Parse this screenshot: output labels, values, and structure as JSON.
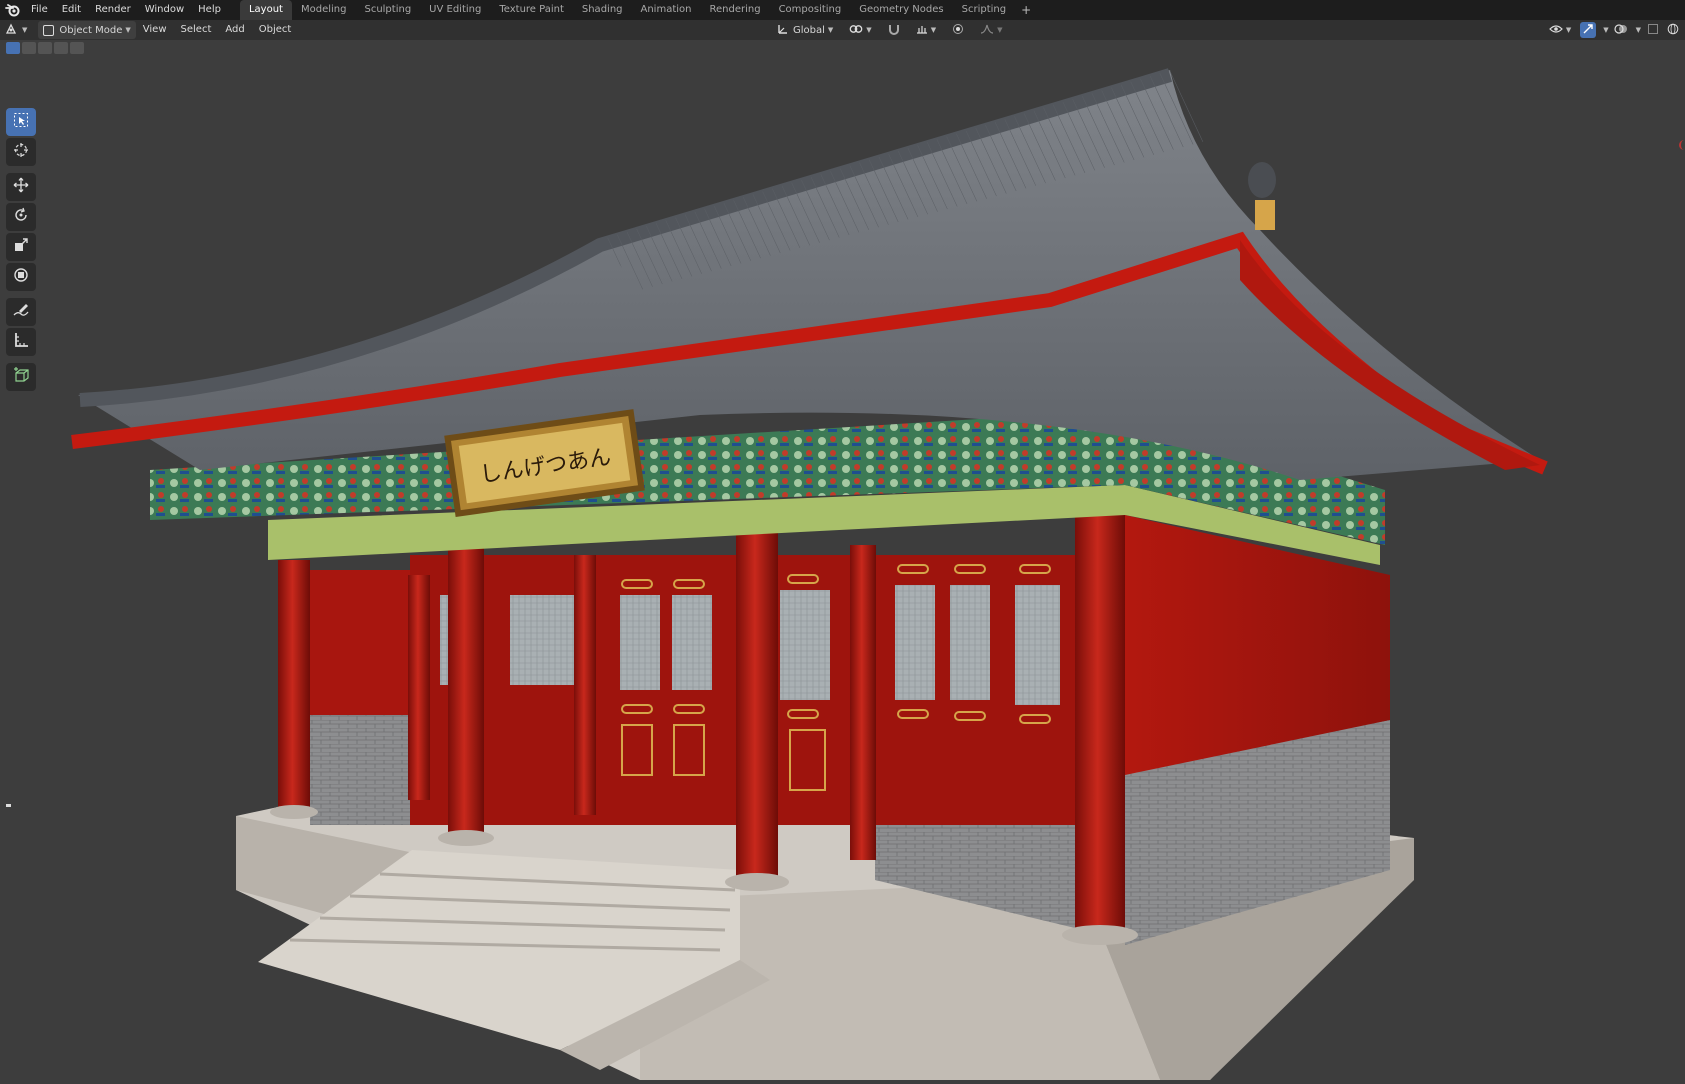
{
  "topbar": {
    "menu": [
      "File",
      "Edit",
      "Render",
      "Window",
      "Help"
    ],
    "workspaces": [
      "Layout",
      "Modeling",
      "Sculpting",
      "UV Editing",
      "Texture Paint",
      "Shading",
      "Animation",
      "Rendering",
      "Compositing",
      "Geometry Nodes",
      "Scripting"
    ],
    "active_workspace": "Layout",
    "add_tab": "+"
  },
  "header": {
    "mode": "Object Mode",
    "menus": [
      "View",
      "Select",
      "Add",
      "Object"
    ],
    "transform_orientation": "Global"
  },
  "toolbar": {
    "tools": [
      "select-box-icon",
      "cursor-icon",
      "move-icon",
      "rotate-icon",
      "scale-icon",
      "transform-icon",
      "annotate-icon",
      "measure-icon",
      "add-cube-icon"
    ],
    "active_tool": "select-box-icon"
  },
  "scene": {
    "signboard_text": "しんげつあん"
  },
  "colors": {
    "viewport_bg": "#3d3d3d",
    "topbar_bg": "#1d1d1d",
    "header_bg": "#303030",
    "accent_blue": "#4772b3",
    "wall_red": "#a8160f",
    "roof_gray": "#6a6e72",
    "stone": "#c9c4bd"
  }
}
